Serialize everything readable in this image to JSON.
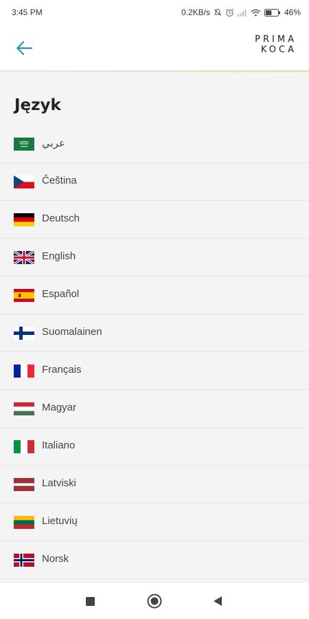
{
  "status_bar": {
    "time": "3:45 PM",
    "speed": "0.2KB/s",
    "battery": "46%"
  },
  "app_bar": {
    "logo_line1": "PRIMA",
    "logo_line2": "KOCA"
  },
  "page": {
    "title": "Język"
  },
  "languages": [
    {
      "label": "عربي",
      "flag": "saudi-arabia-flag-icon"
    },
    {
      "label": "Čeština",
      "flag": "czech-flag-icon"
    },
    {
      "label": "Deutsch",
      "flag": "germany-flag-icon"
    },
    {
      "label": "English",
      "flag": "uk-flag-icon"
    },
    {
      "label": "Español",
      "flag": "spain-flag-icon"
    },
    {
      "label": "Suomalainen",
      "flag": "finland-flag-icon"
    },
    {
      "label": "Français",
      "flag": "france-flag-icon"
    },
    {
      "label": "Magyar",
      "flag": "hungary-flag-icon"
    },
    {
      "label": "Italiano",
      "flag": "italy-flag-icon"
    },
    {
      "label": "Latviski",
      "flag": "latvia-flag-icon"
    },
    {
      "label": "Lietuvių",
      "flag": "lithuania-flag-icon"
    },
    {
      "label": "Norsk",
      "flag": "norway-flag-icon"
    }
  ],
  "colors": {
    "accent": "#2a8fb8",
    "background": "#f4f4f4"
  }
}
